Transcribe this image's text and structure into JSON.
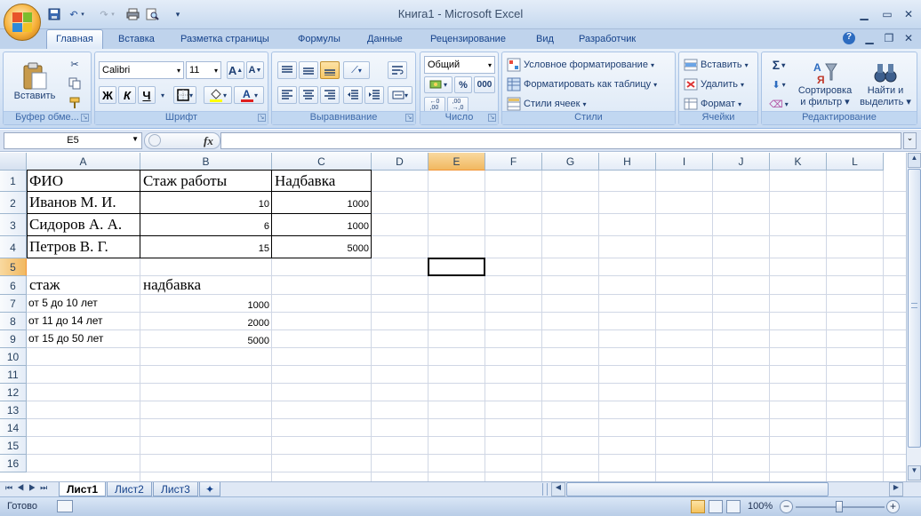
{
  "window": {
    "title": "Книга1 - Microsoft Excel",
    "minimize_icon": "minimize-icon",
    "maximize_icon": "maximize-icon",
    "close_icon": "close-icon"
  },
  "tabs": [
    "Главная",
    "Вставка",
    "Разметка страницы",
    "Формулы",
    "Данные",
    "Рецензирование",
    "Вид",
    "Разработчик"
  ],
  "active_tab": "Главная",
  "ribbon": {
    "clipboard": {
      "paste_label": "Вставить",
      "group_label": "Буфер обме..."
    },
    "font": {
      "name": "Calibri",
      "size": "11",
      "bold": "Ж",
      "italic": "К",
      "underline": "Ч",
      "grow": "A",
      "shrink": "A",
      "group_label": "Шрифт"
    },
    "alignment": {
      "group_label": "Выравнивание"
    },
    "number": {
      "format": "Общий",
      "percent": "%",
      "thousands": "000",
      "group_label": "Число"
    },
    "styles": {
      "conditional": "Условное форматирование",
      "table": "Форматировать как таблицу",
      "cell_styles": "Стили ячеек",
      "group_label": "Стили"
    },
    "cells": {
      "insert": "Вставить",
      "delete": "Удалить",
      "format": "Формат",
      "group_label": "Ячейки"
    },
    "editing": {
      "sum": "Σ",
      "sort_l1": "Сортировка",
      "sort_l2": "и фильтр",
      "find_l1": "Найти и",
      "find_l2": "выделить",
      "group_label": "Редактирование"
    }
  },
  "formula_bar": {
    "name_box": "E5",
    "fx": "fx",
    "value": ""
  },
  "columns": [
    "A",
    "B",
    "C",
    "D",
    "E",
    "F",
    "G",
    "H",
    "I",
    "J",
    "K",
    "L"
  ],
  "rows": [
    "1",
    "2",
    "3",
    "4",
    "5",
    "6",
    "7",
    "8",
    "9",
    "10",
    "11",
    "12",
    "13",
    "14",
    "15",
    "16"
  ],
  "selected": {
    "column": "E",
    "row": "5"
  },
  "cells": {
    "A1": "ФИО",
    "B1": "Стаж работы",
    "C1": "Надбавка",
    "A2": "Иванов М. И.",
    "B2": "10",
    "C2": "1000",
    "A3": "Сидоров А. А.",
    "B3": "6",
    "C3": "1000",
    "A4": "Петров В. Г.",
    "B4": "15",
    "C4": "5000",
    "A6": "стаж",
    "B6": "надбавка",
    "A7": "от 5 до 10 лет",
    "B7": "1000",
    "A8": "от 11 до 14 лет",
    "B8": "2000",
    "A9": "от 15 до 50 лет",
    "B9": "5000"
  },
  "sheets": [
    "Лист1",
    "Лист2",
    "Лист3"
  ],
  "active_sheet": "Лист1",
  "status": {
    "ready": "Готово",
    "zoom": "100%"
  }
}
